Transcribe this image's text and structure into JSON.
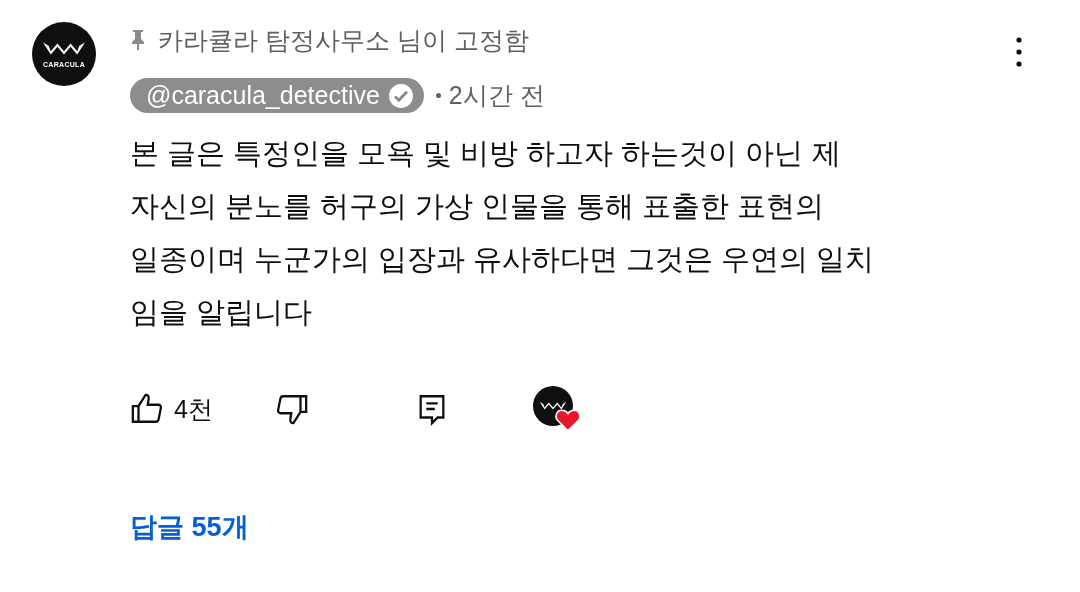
{
  "comment": {
    "avatar_label": "CARACULA",
    "pinned_note": "카라큘라 탐정사무소 님이 고정함",
    "author": "@caracula_detective",
    "verified": true,
    "time": "2시간 전",
    "text": "본 글은 특정인을 모욕 및 비방 하고자 하는것이 아닌 제\n자신의 분노를 허구의 가상 인물을 통해 표출한 표현의\n일종이며 누군가의 입장과 유사하다면 그것은 우연의 일치\n임을 알립니다",
    "likes": "4천",
    "creator_hearted": true,
    "replies": "답글 55개"
  }
}
